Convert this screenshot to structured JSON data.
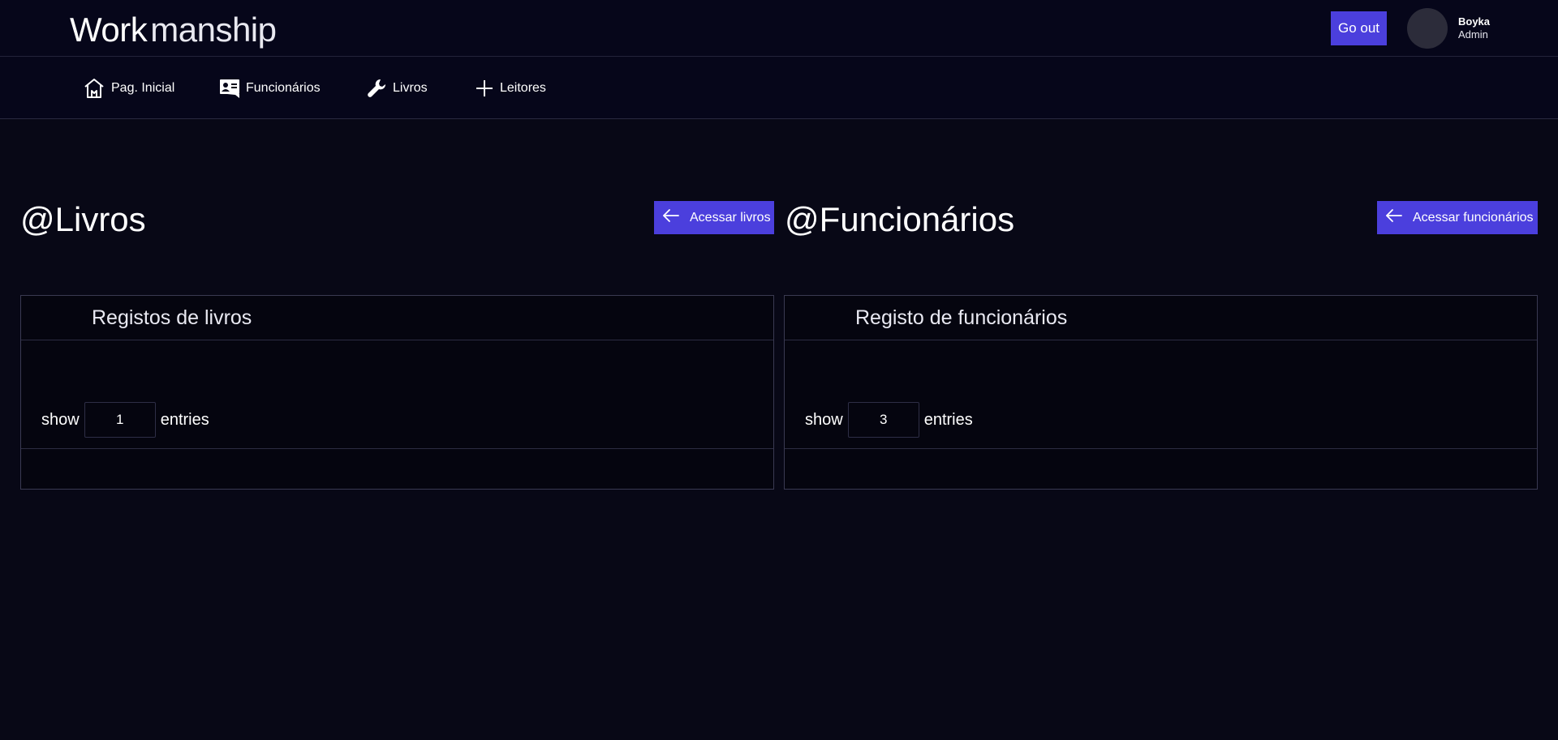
{
  "header": {
    "logo_bold": "Work",
    "logo_light": "manship",
    "goout_label": "Go out",
    "user_name": "Boyka",
    "user_role": "Admin"
  },
  "nav": {
    "items": [
      {
        "label": "Pag. Inicial",
        "icon": "home-icon"
      },
      {
        "label": "Funcionários",
        "icon": "employees-icon"
      },
      {
        "label": "Livros",
        "icon": "wrench-icon"
      },
      {
        "label": "Leitores",
        "icon": "plus-icon"
      }
    ]
  },
  "sections": {
    "livros": {
      "title": "@Livros",
      "button_label": "Acessar livros",
      "panel_title": "Registos de livros",
      "show_label": "show",
      "entries_value": "1",
      "entries_label": "entries"
    },
    "funcionarios": {
      "title": "@Funcionários",
      "button_label": "Acessar funcionários",
      "panel_title": "Registo de funcionários",
      "show_label": "show",
      "entries_value": "3",
      "entries_label": "entries"
    }
  },
  "colors": {
    "background": "#080816",
    "accent": "#4b3fdd",
    "border": "#3a3a52"
  }
}
